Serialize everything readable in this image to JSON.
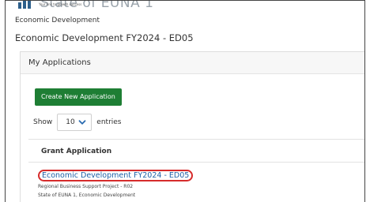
{
  "header": {
    "logo_text": "State of EUNA 1",
    "logo_tagline": "Your link to growth success"
  },
  "breadcrumb": "Economic Development",
  "page_title": "Economic Development FY2024 - ED05",
  "panel": {
    "title": "My Applications",
    "create_button": "Create New Application",
    "show_label": "Show",
    "entries_value": "10",
    "entries_label": "entries",
    "table": {
      "column": "Grant Application",
      "rows": [
        {
          "link": "Economic Development FY2024 - ED05",
          "project": "Regional Business Support Project - R02",
          "agency": "State of EUNA 1, Economic Development"
        }
      ]
    }
  },
  "colors": {
    "button_green": "#1e7e34",
    "link_blue": "#1f5fa6",
    "highlight_red": "#d62b2b"
  }
}
